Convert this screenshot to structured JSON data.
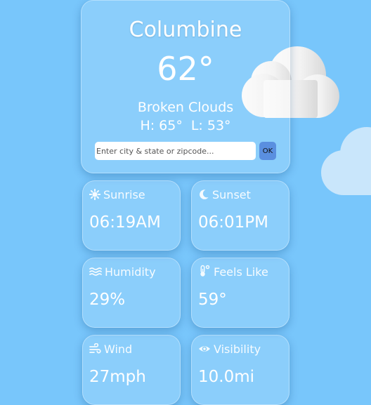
{
  "location": {
    "city": "Columbine",
    "temperature": "62°",
    "description": "Broken Clouds",
    "high": "H: 65°",
    "low": "L: 53°"
  },
  "search": {
    "placeholder": "Enter city & state or zipcode...",
    "button_label": "OK"
  },
  "tiles": [
    {
      "icon": "sun-icon",
      "label": "Sunrise",
      "value": "06:19AM"
    },
    {
      "icon": "moon-icon",
      "label": "Sunset",
      "value": "06:01PM"
    },
    {
      "icon": "humidity-icon",
      "label": "Humidity",
      "value": "29%"
    },
    {
      "icon": "thermometer-icon",
      "label": "Feels Like",
      "value": "59°"
    },
    {
      "icon": "wind-icon",
      "label": "Wind",
      "value": "27mph"
    },
    {
      "icon": "eye-icon",
      "label": "Visibility",
      "value": "10.0mi"
    }
  ],
  "colors": {
    "background": "#78c6fb",
    "button": "#5a8fe0",
    "text": "#ffffff"
  }
}
